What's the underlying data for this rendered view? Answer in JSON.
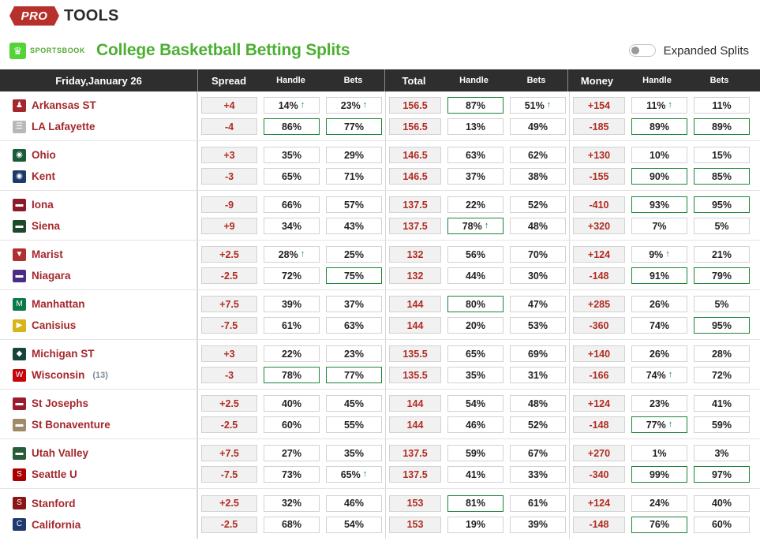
{
  "brand": {
    "logo_badge": "PRO",
    "logo_text": "TOOLS"
  },
  "sportsbook": {
    "mark_icon": "crown-icon",
    "name": "SPORTSBOOK"
  },
  "header": {
    "page_title": "College Basketball Betting Splits",
    "toggle_label": "Expanded Splits",
    "toggle_state": "off"
  },
  "colors": {
    "title_green": "#4caf32",
    "team_red": "#a4272c",
    "line_red": "#b02b22",
    "highlight_green": "#1b8538",
    "header_bar": "#2e2e2e"
  },
  "table": {
    "date_header": "Friday,January 26",
    "groups": [
      {
        "main": "Spread",
        "handle": "Handle",
        "bets": "Bets"
      },
      {
        "main": "Total",
        "handle": "Handle",
        "bets": "Bets"
      },
      {
        "main": "Money",
        "handle": "Handle",
        "bets": "Bets"
      }
    ],
    "games": [
      {
        "teams": [
          {
            "name": "Arkansas ST",
            "rank": "",
            "logo": "wolf-logo",
            "logo_glyph": "♟",
            "logo_bg": "#a4272c"
          },
          {
            "name": "LA Lafayette",
            "rank": "",
            "logo": "keyboard-logo",
            "logo_glyph": "☰",
            "logo_bg": "#b8b8b8"
          }
        ],
        "spread": [
          {
            "v": "+4",
            "hl": false
          },
          {
            "v": "-4",
            "hl": false
          }
        ],
        "spread_handle": [
          {
            "v": "14%",
            "hl": false,
            "arrow": true
          },
          {
            "v": "86%",
            "hl": true
          }
        ],
        "spread_bets": [
          {
            "v": "23%",
            "hl": false,
            "arrow": true
          },
          {
            "v": "77%",
            "hl": true
          }
        ],
        "total": [
          {
            "v": "156.5",
            "hl": false
          },
          {
            "v": "156.5",
            "hl": false
          }
        ],
        "total_handle": [
          {
            "v": "87%",
            "hl": true
          },
          {
            "v": "13%",
            "hl": false
          }
        ],
        "total_bets": [
          {
            "v": "51%",
            "hl": false,
            "arrow": true
          },
          {
            "v": "49%",
            "hl": false
          }
        ],
        "money": [
          {
            "v": "+154",
            "hl": false
          },
          {
            "v": "-185",
            "hl": false
          }
        ],
        "money_handle": [
          {
            "v": "11%",
            "hl": false,
            "arrow": true
          },
          {
            "v": "89%",
            "hl": true
          }
        ],
        "money_bets": [
          {
            "v": "11%",
            "hl": false
          },
          {
            "v": "89%",
            "hl": true
          }
        ]
      },
      {
        "teams": [
          {
            "name": "Ohio",
            "rank": "",
            "logo": "bobcat-logo",
            "logo_glyph": "◉",
            "logo_bg": "#1a5c3a"
          },
          {
            "name": "Kent",
            "rank": "",
            "logo": "flash-logo",
            "logo_glyph": "◉",
            "logo_bg": "#1d3a6e"
          }
        ],
        "spread": [
          {
            "v": "+3",
            "hl": false
          },
          {
            "v": "-3",
            "hl": false
          }
        ],
        "spread_handle": [
          {
            "v": "35%",
            "hl": false
          },
          {
            "v": "65%",
            "hl": false
          }
        ],
        "spread_bets": [
          {
            "v": "29%",
            "hl": false
          },
          {
            "v": "71%",
            "hl": false
          }
        ],
        "total": [
          {
            "v": "146.5",
            "hl": false
          },
          {
            "v": "146.5",
            "hl": false
          }
        ],
        "total_handle": [
          {
            "v": "63%",
            "hl": false
          },
          {
            "v": "37%",
            "hl": false
          }
        ],
        "total_bets": [
          {
            "v": "62%",
            "hl": false
          },
          {
            "v": "38%",
            "hl": false
          }
        ],
        "money": [
          {
            "v": "+130",
            "hl": false
          },
          {
            "v": "-155",
            "hl": false
          }
        ],
        "money_handle": [
          {
            "v": "10%",
            "hl": false
          },
          {
            "v": "90%",
            "hl": true
          }
        ],
        "money_bets": [
          {
            "v": "15%",
            "hl": false
          },
          {
            "v": "85%",
            "hl": true
          }
        ]
      },
      {
        "teams": [
          {
            "name": "Iona",
            "rank": "",
            "logo": "gaels-logo",
            "logo_glyph": "▬",
            "logo_bg": "#8b1a2b"
          },
          {
            "name": "Siena",
            "rank": "",
            "logo": "saints-logo",
            "logo_glyph": "▬",
            "logo_bg": "#1d4a2a"
          }
        ],
        "spread": [
          {
            "v": "-9",
            "hl": false
          },
          {
            "v": "+9",
            "hl": false
          }
        ],
        "spread_handle": [
          {
            "v": "66%",
            "hl": false
          },
          {
            "v": "34%",
            "hl": false
          }
        ],
        "spread_bets": [
          {
            "v": "57%",
            "hl": false
          },
          {
            "v": "43%",
            "hl": false
          }
        ],
        "total": [
          {
            "v": "137.5",
            "hl": false
          },
          {
            "v": "137.5",
            "hl": false
          }
        ],
        "total_handle": [
          {
            "v": "22%",
            "hl": false
          },
          {
            "v": "78%",
            "hl": true,
            "arrow": true
          }
        ],
        "total_bets": [
          {
            "v": "52%",
            "hl": false
          },
          {
            "v": "48%",
            "hl": false
          }
        ],
        "money": [
          {
            "v": "-410",
            "hl": false
          },
          {
            "v": "+320",
            "hl": false
          }
        ],
        "money_handle": [
          {
            "v": "93%",
            "hl": true
          },
          {
            "v": "7%",
            "hl": false
          }
        ],
        "money_bets": [
          {
            "v": "95%",
            "hl": true
          },
          {
            "v": "5%",
            "hl": false
          }
        ]
      },
      {
        "teams": [
          {
            "name": "Marist",
            "rank": "",
            "logo": "redfox-logo",
            "logo_glyph": "▼",
            "logo_bg": "#b03030"
          },
          {
            "name": "Niagara",
            "rank": "",
            "logo": "purple-eagles-logo",
            "logo_glyph": "▬",
            "logo_bg": "#4b2e83"
          }
        ],
        "spread": [
          {
            "v": "+2.5",
            "hl": false
          },
          {
            "v": "-2.5",
            "hl": false
          }
        ],
        "spread_handle": [
          {
            "v": "28%",
            "hl": false,
            "arrow": true
          },
          {
            "v": "72%",
            "hl": false
          }
        ],
        "spread_bets": [
          {
            "v": "25%",
            "hl": false
          },
          {
            "v": "75%",
            "hl": true
          }
        ],
        "total": [
          {
            "v": "132",
            "hl": false
          },
          {
            "v": "132",
            "hl": false
          }
        ],
        "total_handle": [
          {
            "v": "56%",
            "hl": false
          },
          {
            "v": "44%",
            "hl": false
          }
        ],
        "total_bets": [
          {
            "v": "70%",
            "hl": false
          },
          {
            "v": "30%",
            "hl": false
          }
        ],
        "money": [
          {
            "v": "+124",
            "hl": false
          },
          {
            "v": "-148",
            "hl": false
          }
        ],
        "money_handle": [
          {
            "v": "9%",
            "hl": false,
            "arrow": true
          },
          {
            "v": "91%",
            "hl": true
          }
        ],
        "money_bets": [
          {
            "v": "21%",
            "hl": false
          },
          {
            "v": "79%",
            "hl": true
          }
        ]
      },
      {
        "teams": [
          {
            "name": "Manhattan",
            "rank": "",
            "logo": "jaspers-logo",
            "logo_glyph": "M",
            "logo_bg": "#0b7a4b"
          },
          {
            "name": "Canisius",
            "rank": "",
            "logo": "griffs-logo",
            "logo_glyph": "▶",
            "logo_bg": "#d8b41a"
          }
        ],
        "spread": [
          {
            "v": "+7.5",
            "hl": false
          },
          {
            "v": "-7.5",
            "hl": false
          }
        ],
        "spread_handle": [
          {
            "v": "39%",
            "hl": false
          },
          {
            "v": "61%",
            "hl": false
          }
        ],
        "spread_bets": [
          {
            "v": "37%",
            "hl": false
          },
          {
            "v": "63%",
            "hl": false
          }
        ],
        "total": [
          {
            "v": "144",
            "hl": false
          },
          {
            "v": "144",
            "hl": false
          }
        ],
        "total_handle": [
          {
            "v": "80%",
            "hl": true
          },
          {
            "v": "20%",
            "hl": false
          }
        ],
        "total_bets": [
          {
            "v": "47%",
            "hl": false
          },
          {
            "v": "53%",
            "hl": false
          }
        ],
        "money": [
          {
            "v": "+285",
            "hl": false
          },
          {
            "v": "-360",
            "hl": false
          }
        ],
        "money_handle": [
          {
            "v": "26%",
            "hl": false
          },
          {
            "v": "74%",
            "hl": false
          }
        ],
        "money_bets": [
          {
            "v": "5%",
            "hl": false
          },
          {
            "v": "95%",
            "hl": true
          }
        ]
      },
      {
        "teams": [
          {
            "name": "Michigan ST",
            "rank": "",
            "logo": "spartans-logo",
            "logo_glyph": "◆",
            "logo_bg": "#18453b"
          },
          {
            "name": "Wisconsin",
            "rank": "(13)",
            "logo": "badgers-logo",
            "logo_glyph": "W",
            "logo_bg": "#c5050c"
          }
        ],
        "spread": [
          {
            "v": "+3",
            "hl": false
          },
          {
            "v": "-3",
            "hl": false
          }
        ],
        "spread_handle": [
          {
            "v": "22%",
            "hl": false
          },
          {
            "v": "78%",
            "hl": true
          }
        ],
        "spread_bets": [
          {
            "v": "23%",
            "hl": false
          },
          {
            "v": "77%",
            "hl": true
          }
        ],
        "total": [
          {
            "v": "135.5",
            "hl": false
          },
          {
            "v": "135.5",
            "hl": false
          }
        ],
        "total_handle": [
          {
            "v": "65%",
            "hl": false
          },
          {
            "v": "35%",
            "hl": false
          }
        ],
        "total_bets": [
          {
            "v": "69%",
            "hl": false
          },
          {
            "v": "31%",
            "hl": false
          }
        ],
        "money": [
          {
            "v": "+140",
            "hl": false
          },
          {
            "v": "-166",
            "hl": false
          }
        ],
        "money_handle": [
          {
            "v": "26%",
            "hl": false
          },
          {
            "v": "74%",
            "hl": false,
            "arrow": true
          }
        ],
        "money_bets": [
          {
            "v": "28%",
            "hl": false
          },
          {
            "v": "72%",
            "hl": false
          }
        ]
      },
      {
        "teams": [
          {
            "name": "St Josephs",
            "rank": "",
            "logo": "hawks-logo",
            "logo_glyph": "▬",
            "logo_bg": "#9c1c2e"
          },
          {
            "name": "St Bonaventure",
            "rank": "",
            "logo": "bonnies-logo",
            "logo_glyph": "▬",
            "logo_bg": "#a08a6a"
          }
        ],
        "spread": [
          {
            "v": "+2.5",
            "hl": false
          },
          {
            "v": "-2.5",
            "hl": false
          }
        ],
        "spread_handle": [
          {
            "v": "40%",
            "hl": false
          },
          {
            "v": "60%",
            "hl": false
          }
        ],
        "spread_bets": [
          {
            "v": "45%",
            "hl": false
          },
          {
            "v": "55%",
            "hl": false
          }
        ],
        "total": [
          {
            "v": "144",
            "hl": false
          },
          {
            "v": "144",
            "hl": false
          }
        ],
        "total_handle": [
          {
            "v": "54%",
            "hl": false
          },
          {
            "v": "46%",
            "hl": false
          }
        ],
        "total_bets": [
          {
            "v": "48%",
            "hl": false
          },
          {
            "v": "52%",
            "hl": false
          }
        ],
        "money": [
          {
            "v": "+124",
            "hl": false
          },
          {
            "v": "-148",
            "hl": false
          }
        ],
        "money_handle": [
          {
            "v": "23%",
            "hl": false
          },
          {
            "v": "77%",
            "hl": true,
            "arrow": true
          }
        ],
        "money_bets": [
          {
            "v": "41%",
            "hl": false
          },
          {
            "v": "59%",
            "hl": false
          }
        ]
      },
      {
        "teams": [
          {
            "name": "Utah Valley",
            "rank": "",
            "logo": "wolverines-logo",
            "logo_glyph": "▬",
            "logo_bg": "#275d38"
          },
          {
            "name": "Seattle U",
            "rank": "",
            "logo": "redhawks-logo",
            "logo_glyph": "S",
            "logo_bg": "#aa0000"
          }
        ],
        "spread": [
          {
            "v": "+7.5",
            "hl": false
          },
          {
            "v": "-7.5",
            "hl": false
          }
        ],
        "spread_handle": [
          {
            "v": "27%",
            "hl": false
          },
          {
            "v": "73%",
            "hl": false
          }
        ],
        "spread_bets": [
          {
            "v": "35%",
            "hl": false
          },
          {
            "v": "65%",
            "hl": false,
            "arrow": true
          }
        ],
        "total": [
          {
            "v": "137.5",
            "hl": false
          },
          {
            "v": "137.5",
            "hl": false
          }
        ],
        "total_handle": [
          {
            "v": "59%",
            "hl": false
          },
          {
            "v": "41%",
            "hl": false
          }
        ],
        "total_bets": [
          {
            "v": "67%",
            "hl": false
          },
          {
            "v": "33%",
            "hl": false
          }
        ],
        "money": [
          {
            "v": "+270",
            "hl": false
          },
          {
            "v": "-340",
            "hl": false
          }
        ],
        "money_handle": [
          {
            "v": "1%",
            "hl": false
          },
          {
            "v": "99%",
            "hl": true
          }
        ],
        "money_bets": [
          {
            "v": "3%",
            "hl": false
          },
          {
            "v": "97%",
            "hl": true
          }
        ]
      },
      {
        "teams": [
          {
            "name": "Stanford",
            "rank": "",
            "logo": "cardinal-logo",
            "logo_glyph": "S",
            "logo_bg": "#8c1515"
          },
          {
            "name": "California",
            "rank": "",
            "logo": "golden-bears-logo",
            "logo_glyph": "C",
            "logo_bg": "#1e3a6e"
          }
        ],
        "spread": [
          {
            "v": "+2.5",
            "hl": false
          },
          {
            "v": "-2.5",
            "hl": false
          }
        ],
        "spread_handle": [
          {
            "v": "32%",
            "hl": false
          },
          {
            "v": "68%",
            "hl": false
          }
        ],
        "spread_bets": [
          {
            "v": "46%",
            "hl": false
          },
          {
            "v": "54%",
            "hl": false
          }
        ],
        "total": [
          {
            "v": "153",
            "hl": false
          },
          {
            "v": "153",
            "hl": false
          }
        ],
        "total_handle": [
          {
            "v": "81%",
            "hl": true
          },
          {
            "v": "19%",
            "hl": false
          }
        ],
        "total_bets": [
          {
            "v": "61%",
            "hl": false
          },
          {
            "v": "39%",
            "hl": false
          }
        ],
        "money": [
          {
            "v": "+124",
            "hl": false
          },
          {
            "v": "-148",
            "hl": false
          }
        ],
        "money_handle": [
          {
            "v": "24%",
            "hl": false
          },
          {
            "v": "76%",
            "hl": true
          }
        ],
        "money_bets": [
          {
            "v": "40%",
            "hl": false
          },
          {
            "v": "60%",
            "hl": false
          }
        ]
      }
    ]
  }
}
